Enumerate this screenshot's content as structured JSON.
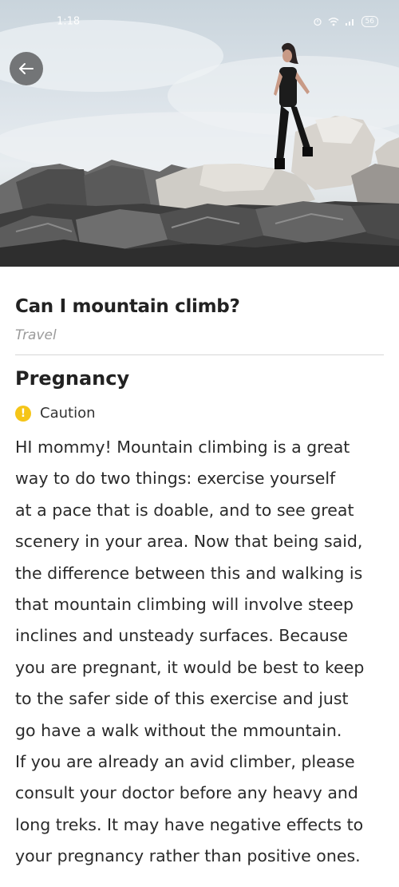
{
  "status_bar": {
    "time": "1:18",
    "battery": "56"
  },
  "hero": {
    "back_icon": "back-arrow-icon"
  },
  "article": {
    "title": "Can I mountain climb?",
    "category": "Travel",
    "section_title": "Pregnancy",
    "status": {
      "icon": "caution-icon",
      "label": "Caution",
      "color": "#f5c518"
    },
    "body_lines": [
      "HI mommy! Mountain climbing is a great",
      "way to do two things: exercise yourself",
      "at a pace that is doable, and to see great",
      "scenery in your area. Now that being said,",
      "the difference between this and walking is",
      "that mountain climbing will involve steep",
      "inclines and unsteady surfaces. Because",
      "you are pregnant, it would be best to keep",
      "to the safer side of this exercise and just",
      "go have a walk without the mmountain.",
      "If you are already an avid climber, please",
      "consult your doctor before any heavy and",
      "long treks. It may have negative effects to",
      "your pregnancy rather than positive ones."
    ]
  }
}
